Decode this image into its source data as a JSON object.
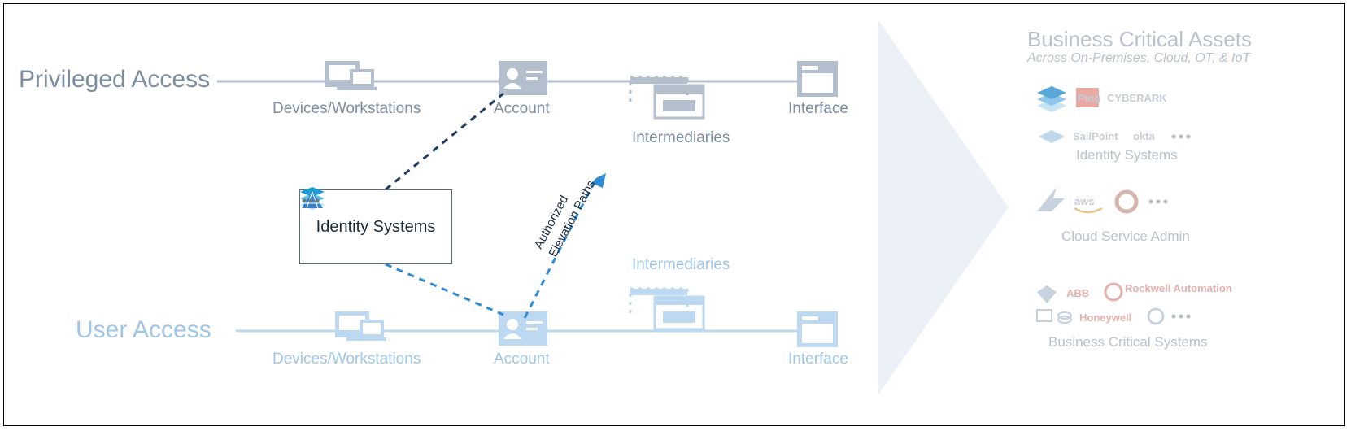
{
  "rows": {
    "privileged": {
      "title": "Privileged Access",
      "devices": "Devices/Workstations",
      "account": "Account",
      "intermediaries": "Intermediaries",
      "interface": "Interface"
    },
    "user": {
      "title": "User Access",
      "devices": "Devices/Workstations",
      "account": "Account",
      "intermediaries": "Intermediaries",
      "interface": "Interface"
    }
  },
  "center_card": {
    "caption": "Identity Systems"
  },
  "elevation_arrow": {
    "line1": "Authorized",
    "line2": "Elevation Paths"
  },
  "sidebar": {
    "title": "Business Critical Assets",
    "subtitle": "Across On-Premises, Cloud, OT, & IoT",
    "section1": "Identity Systems",
    "section2": "Cloud Service Admin",
    "section3": "Business Critical Systems",
    "vendors1": [
      "Ping",
      "CYBERARK",
      "SailPoint",
      "okta"
    ],
    "vendors2": [
      "aws"
    ],
    "vendors3": [
      "ABB",
      "Rockwell Automation",
      "Honeywell"
    ]
  }
}
